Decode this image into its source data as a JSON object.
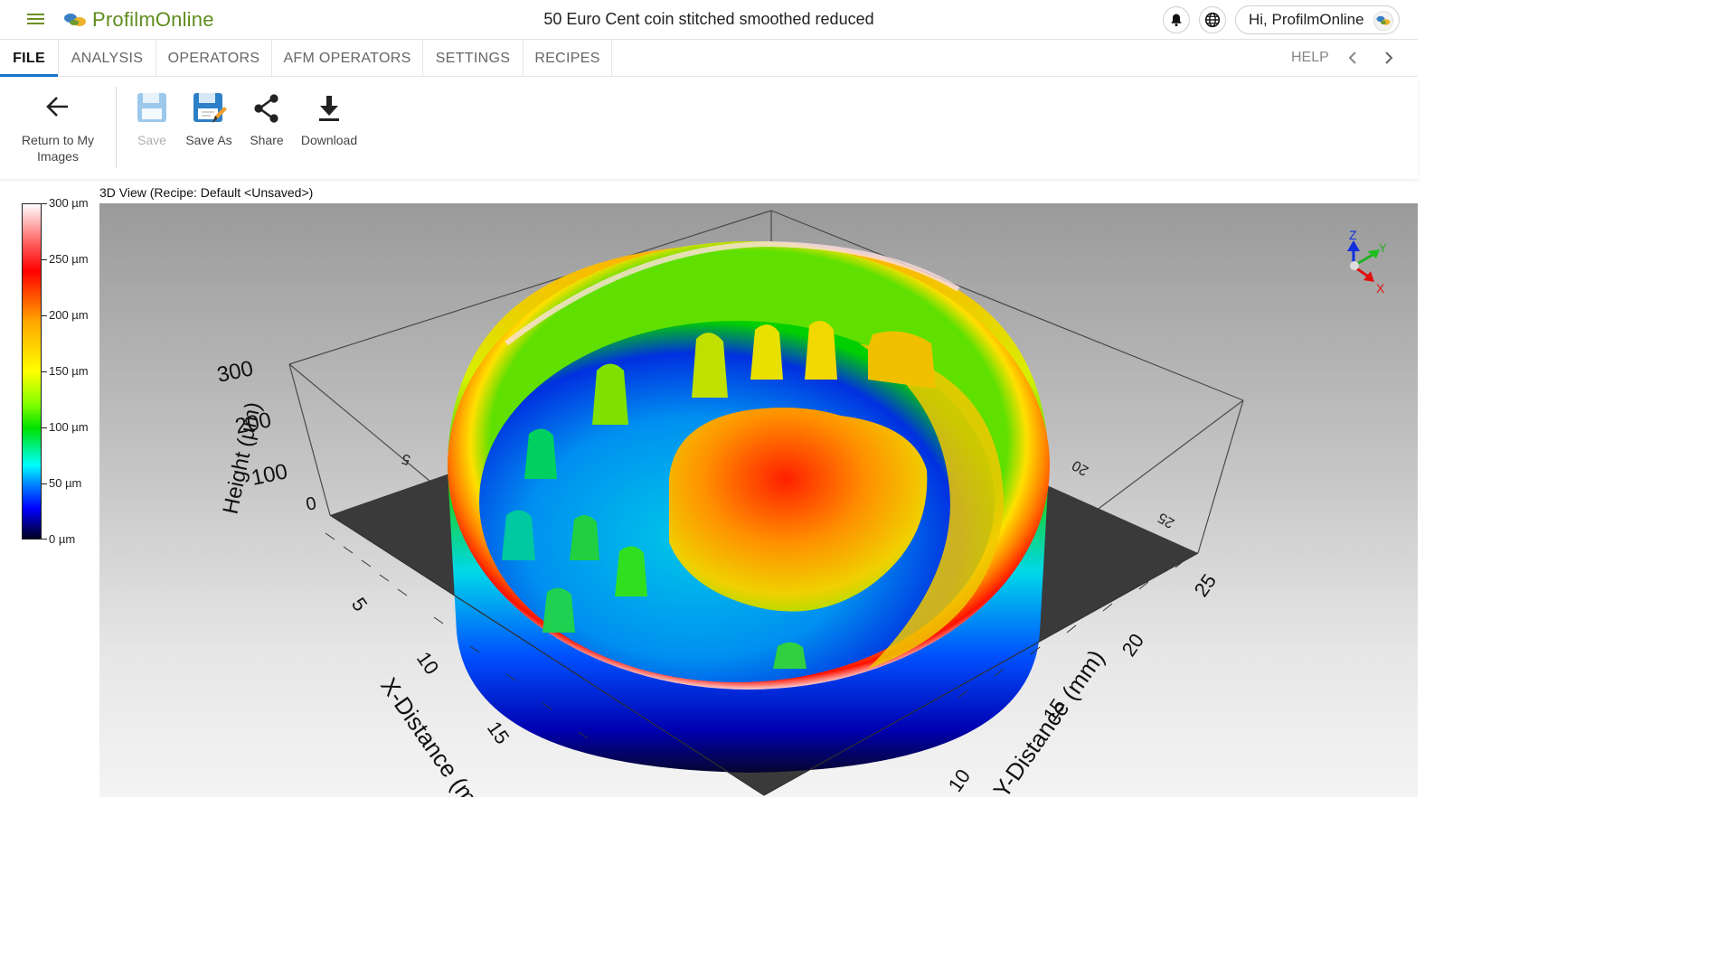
{
  "app": {
    "name": "ProfilmOnline",
    "doc_title": "50 Euro Cent coin stitched smoothed reduced"
  },
  "header": {
    "user_greeting": "Hi, ProfilmOnline",
    "icons": [
      "menu-icon",
      "bell-icon",
      "globe-icon"
    ]
  },
  "tabs": [
    {
      "label": "FILE",
      "active": true
    },
    {
      "label": "ANALYSIS"
    },
    {
      "label": "OPERATORS"
    },
    {
      "label": "AFM OPERATORS"
    },
    {
      "label": "SETTINGS"
    },
    {
      "label": "RECIPES"
    }
  ],
  "help_label": "HELP",
  "toolbar": {
    "return_label": "Return to My Images",
    "save_label": "Save",
    "save_as_label": "Save As",
    "share_label": "Share",
    "download_label": "Download"
  },
  "view": {
    "title": "3D View (Recipe: Default <Unsaved>)",
    "colorbar_labels": [
      "300 µm",
      "250 µm",
      "200 µm",
      "150 µm",
      "100 µm",
      "50 µm",
      "0 µm"
    ],
    "height_axis": {
      "label": "Height (µm)",
      "ticks": [
        "300",
        "200",
        "100",
        "0"
      ]
    },
    "x_axis": {
      "label": "X-Distance (mm)",
      "ticks": [
        "5",
        "10",
        "15"
      ]
    },
    "y_axis": {
      "label": "Y-Distance (mm)",
      "ticks": [
        "10",
        "15",
        "20",
        "25"
      ]
    },
    "back_ticks": [
      "5",
      "20",
      "25"
    ],
    "triad": {
      "z": "Z",
      "y": "Y",
      "x": "X"
    },
    "colors": {
      "high": "#ff0000",
      "mid": "#ffff00",
      "low": "#0000ff"
    }
  }
}
